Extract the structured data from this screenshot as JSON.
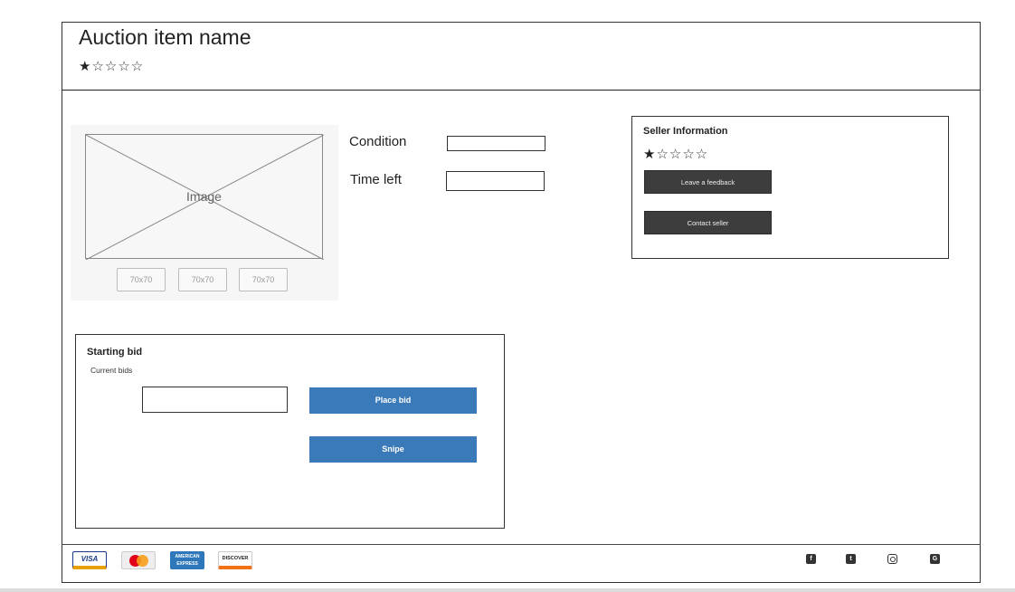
{
  "header": {
    "title": "Auction item name",
    "rating": {
      "filled": "★",
      "empty": "☆☆☆☆",
      "value": 1,
      "max": 5
    }
  },
  "gallery": {
    "image_label": "Image",
    "thumbnails": [
      "70x70",
      "70x70",
      "70x70"
    ]
  },
  "details": {
    "condition_label": "Condition",
    "condition_value": "",
    "time_left_label": "Time left",
    "time_left_value": ""
  },
  "seller": {
    "title": "Seller Information",
    "rating": {
      "filled": "★",
      "empty": "☆☆☆☆",
      "value": 1,
      "max": 5
    },
    "feedback_button": "Leave a feedback",
    "contact_button": "Contact seller"
  },
  "bid": {
    "title": "Starting bid",
    "current_bids_label": "Current bids",
    "input_value": "",
    "place_bid_button": "Place bid",
    "snipe_button": "Snipe"
  },
  "footer": {
    "payment_cards": [
      {
        "name": "visa-card-icon",
        "text": "VISA"
      },
      {
        "name": "mastercard-icon",
        "text": ""
      },
      {
        "name": "amex-card-icon",
        "text": "AMERICAN EXPRESS"
      },
      {
        "name": "discover-card-icon",
        "text": "DISCOVER"
      }
    ],
    "social_icons": [
      "facebook-icon",
      "twitter-icon",
      "instagram-icon",
      "google-plus-icon"
    ]
  },
  "colors": {
    "primary_button": "#3a7ab8",
    "dark_button": "#3d3d3d"
  }
}
